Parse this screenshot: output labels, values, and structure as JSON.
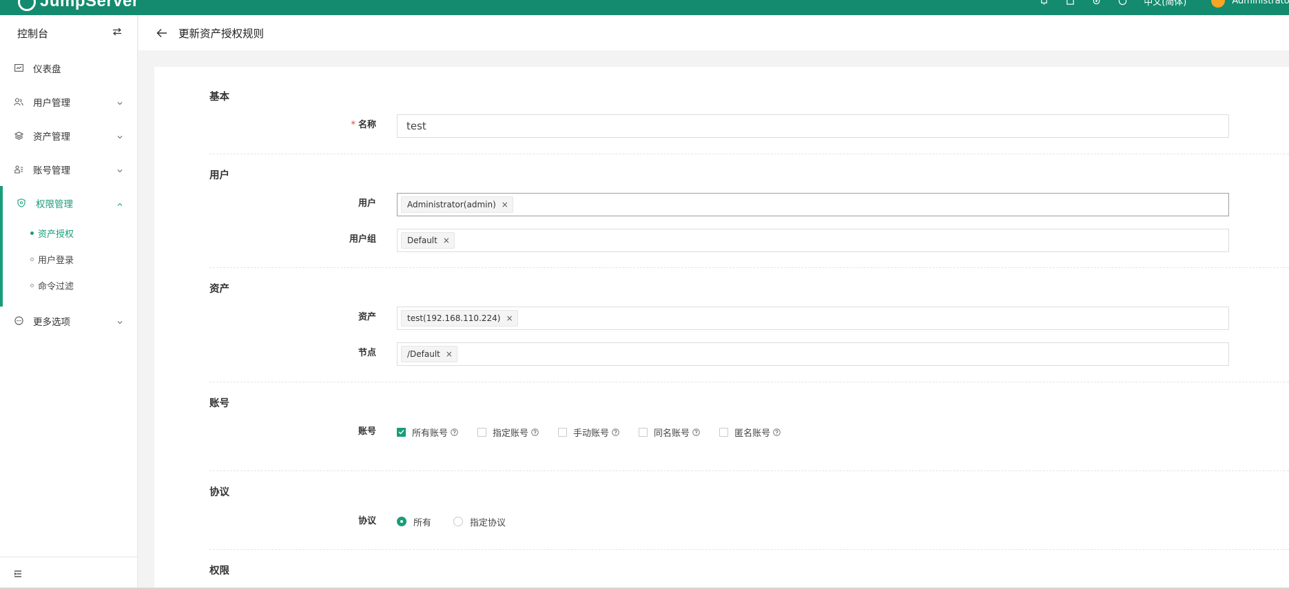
{
  "topbar": {
    "logo_text": "JumpServer",
    "language": "中文(简体)",
    "user_name": "Administrator"
  },
  "sidebar": {
    "title": "控制台",
    "items": [
      {
        "label": "仪表盘",
        "icon": "dashboard-icon"
      },
      {
        "label": "用户管理",
        "icon": "users-icon"
      },
      {
        "label": "资产管理",
        "icon": "layers-icon"
      },
      {
        "label": "账号管理",
        "icon": "account-icon"
      },
      {
        "label": "权限管理",
        "icon": "shield-icon"
      }
    ],
    "perm_sub": [
      {
        "label": "资产授权"
      },
      {
        "label": "用户登录"
      },
      {
        "label": "命令过滤"
      }
    ],
    "more": {
      "label": "更多选项",
      "icon": "more-icon"
    }
  },
  "header": {
    "title": "更新资产授权规则"
  },
  "form": {
    "basic": {
      "title": "基本",
      "name_label": "名称",
      "name_value": "test"
    },
    "user": {
      "title": "用户",
      "users_label": "用户",
      "users_tags": [
        "Administrator(admin)"
      ],
      "groups_label": "用户组",
      "groups_tags": [
        "Default"
      ]
    },
    "asset": {
      "title": "资产",
      "assets_label": "资产",
      "assets_tags": [
        "test(192.168.110.224)"
      ],
      "nodes_label": "节点",
      "nodes_tags": [
        "/Default"
      ]
    },
    "account": {
      "title": "账号",
      "label": "账号",
      "options": [
        {
          "label": "所有账号",
          "checked": true
        },
        {
          "label": "指定账号",
          "checked": false
        },
        {
          "label": "手动账号",
          "checked": false
        },
        {
          "label": "同名账号",
          "checked": false
        },
        {
          "label": "匿名账号",
          "checked": false
        }
      ]
    },
    "protocol": {
      "title": "协议",
      "label": "协议",
      "options": [
        {
          "label": "所有",
          "selected": true
        },
        {
          "label": "指定协议",
          "selected": false
        }
      ]
    },
    "permission": {
      "title": "权限"
    }
  },
  "colors": {
    "brand": "#148b6e",
    "accent": "#1a9c7a",
    "required": "#e0413f"
  }
}
